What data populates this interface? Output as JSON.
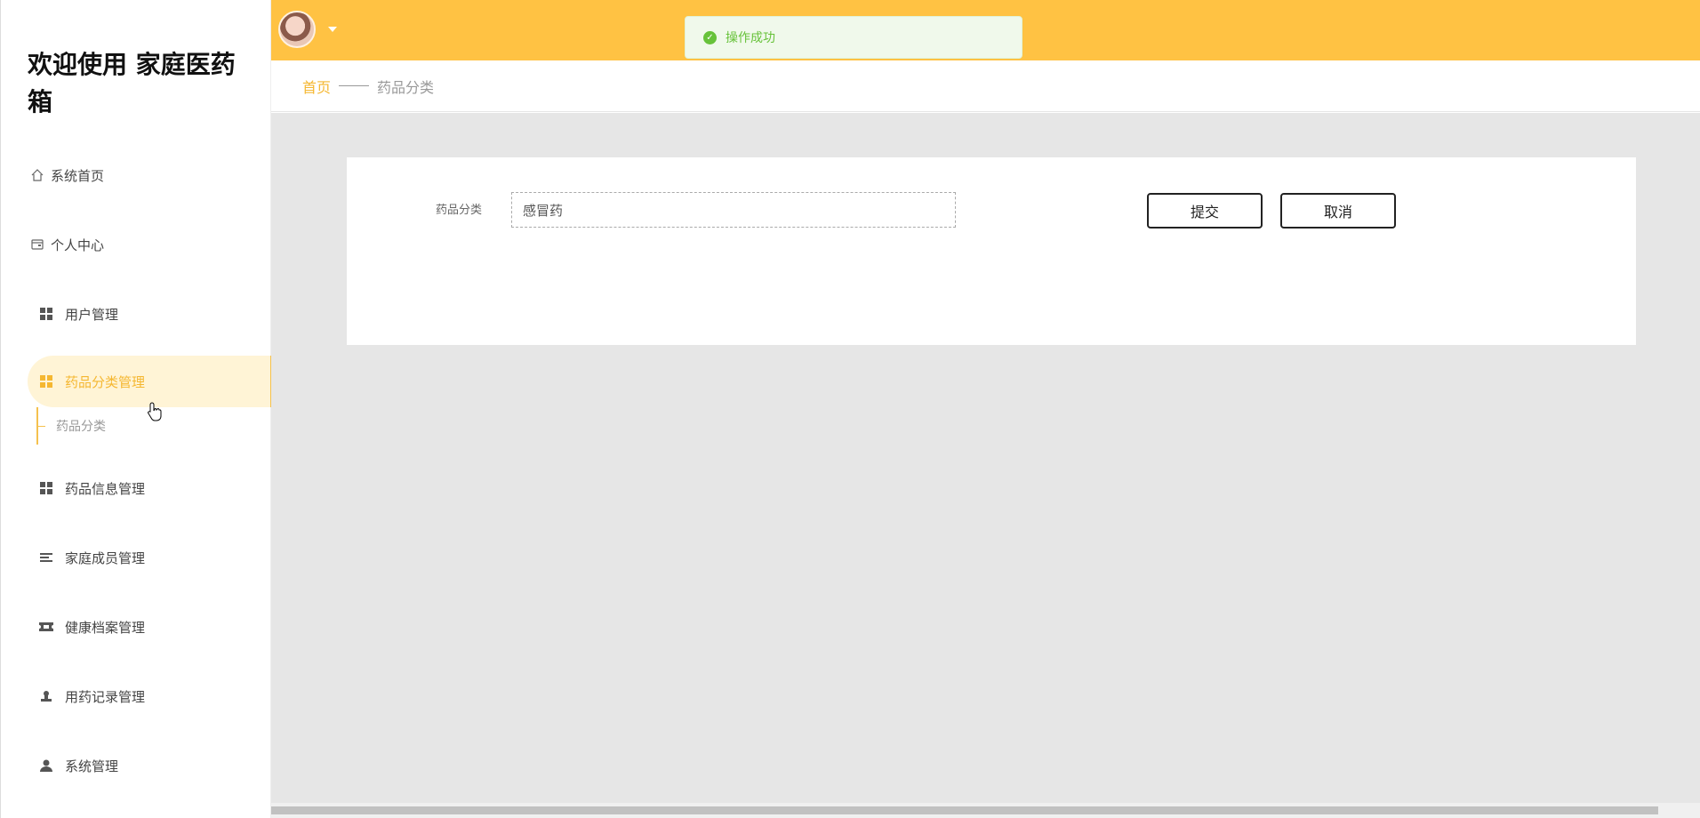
{
  "sidebar": {
    "brand": "欢迎使用 家庭医药箱",
    "items": [
      {
        "label": "系统首页",
        "icon": "home-icon"
      },
      {
        "label": "个人中心",
        "icon": "card-icon"
      },
      {
        "label": "用户管理",
        "icon": "grid-icon"
      },
      {
        "label": "药品分类管理",
        "icon": "grid-icon",
        "active": true
      },
      {
        "label": "药品信息管理",
        "icon": "grid-icon"
      },
      {
        "label": "家庭成员管理",
        "icon": "list-icon"
      },
      {
        "label": "健康档案管理",
        "icon": "ticket-icon"
      },
      {
        "label": "用药记录管理",
        "icon": "stamp-icon"
      },
      {
        "label": "系统管理",
        "icon": "user-icon"
      }
    ],
    "submenu": {
      "label": "药品分类"
    }
  },
  "toast": {
    "message": "操作成功",
    "color": "#67c23a"
  },
  "breadcrumb": {
    "home": "首页",
    "current": "药品分类"
  },
  "form": {
    "label": "药品分类",
    "value": "感冒药",
    "submit_label": "提交",
    "cancel_label": "取消"
  },
  "colors": {
    "accent": "#ffc243",
    "active_text": "#f5b731",
    "active_bg": "#fff4d6"
  }
}
